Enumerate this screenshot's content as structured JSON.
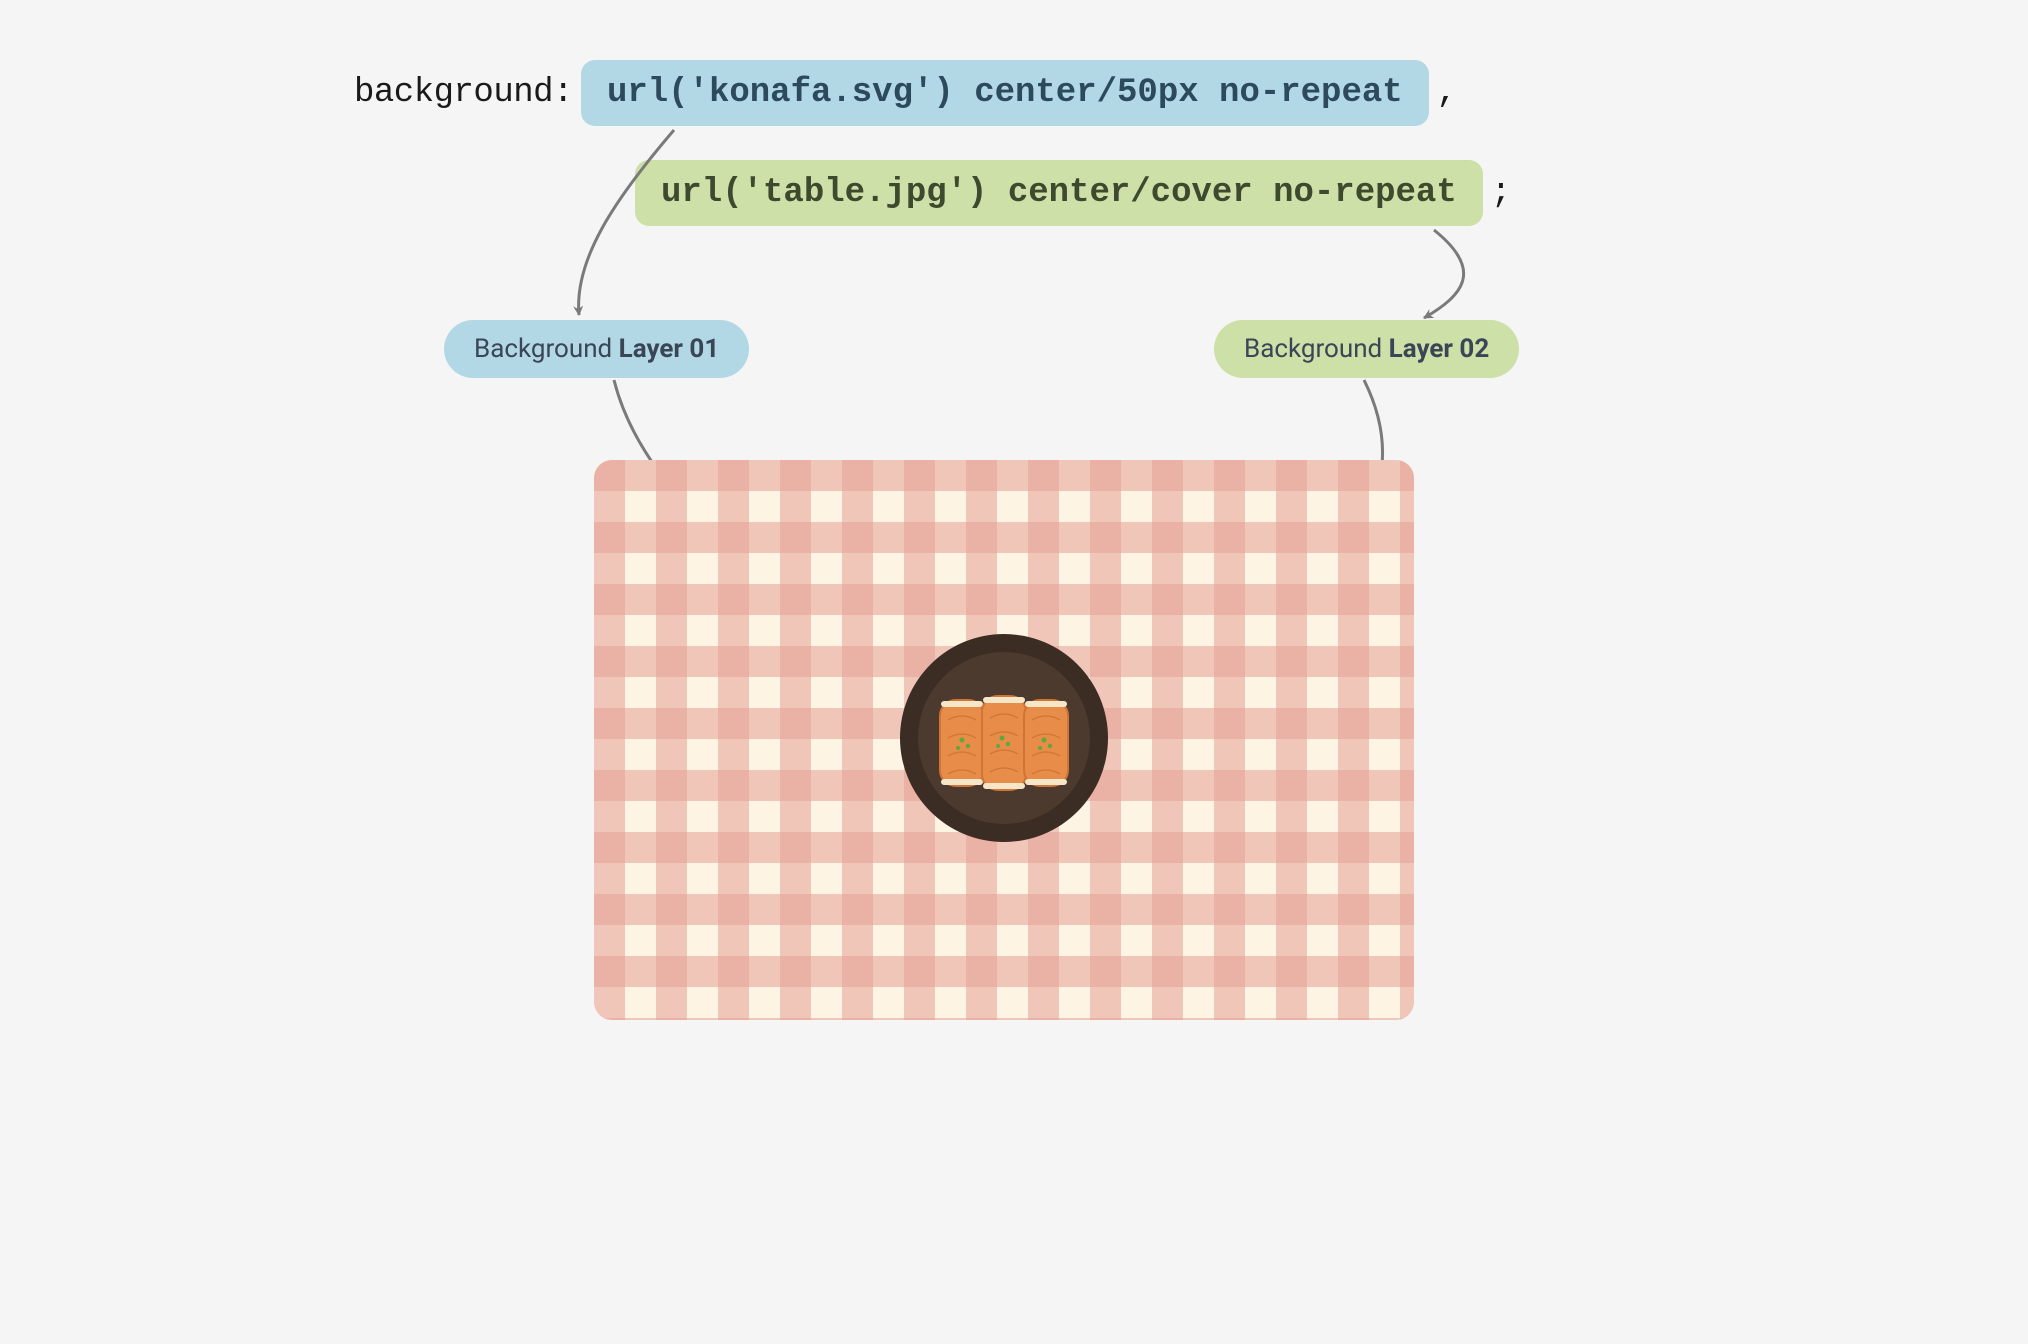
{
  "code": {
    "property": "background:",
    "layer1_value": "url('konafa.svg') center/50px no-repeat",
    "separator": ",",
    "layer2_value": "url('table.jpg') center/cover no-repeat",
    "terminator": ";"
  },
  "badges": {
    "layer1_prefix": "Background ",
    "layer1_bold": "Layer 01",
    "layer2_prefix": "Background ",
    "layer2_bold": "Layer 02"
  },
  "colors": {
    "blue": "#b2d8e6",
    "green": "#cde0a8",
    "arrow": "#7a7a7a",
    "plate_outer": "#3b2c24",
    "plate_inner": "#4d3a2e",
    "food": "#e88c4a",
    "garnish": "#5fa83d",
    "cloth_base": "#fdf4e3",
    "cloth_stripe": "#e9a79b"
  }
}
